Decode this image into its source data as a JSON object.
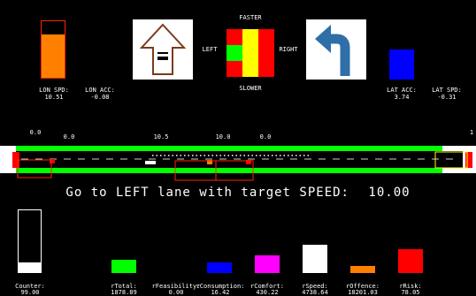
{
  "top": {
    "lon_spd_label": "LON SPD:",
    "lon_spd_value": "10.51",
    "lon_acc_label": "LON ACC:",
    "lon_acc_value": "-0.08",
    "lat_acc_label": "LAT ACC:",
    "lat_acc_value": "3.74",
    "lat_spd_label": "LAT SPD:",
    "lat_spd_value": "-0.31",
    "faster_label": "FASTER",
    "slower_label": "SLOWER",
    "left_label": "LEFT",
    "right_label": "RIGHT",
    "lon_spd_fill_fraction": 0.76,
    "colors": {
      "orange": "#ff8000",
      "blue": "#0000ff",
      "green": "#00ff00",
      "red": "#ff0000",
      "yellow": "#ffff00"
    }
  },
  "road": {
    "distance_labels": [
      "0.0",
      "0.0",
      "10.5",
      "10.0",
      "0.0",
      "1"
    ],
    "colors": {
      "lane": "#00ff00",
      "vehicle": "#ff0000"
    }
  },
  "instruction": {
    "text": "Go to LEFT lane with target SPEED:",
    "speed": "10.00"
  },
  "bottom": {
    "metrics": [
      {
        "label": "Counter:",
        "value": "99.00",
        "color": "#ffffff"
      },
      {
        "label": "rTotal:",
        "value": "1878.89",
        "color": "#00ff00"
      },
      {
        "label": "rFeasibility:",
        "value": "0.00",
        "color": "#000000"
      },
      {
        "label": "rConsumption:",
        "value": "16.42",
        "color": "#0000ff"
      },
      {
        "label": "rComfort:",
        "value": "430.22",
        "color": "#ff00ff"
      },
      {
        "label": "rSpeed:",
        "value": "4738.64",
        "color": "#ffffff"
      },
      {
        "label": "rOffence:",
        "value": "18201.03",
        "color": "#ff8000"
      },
      {
        "label": "rRisk:",
        "value": "78.05",
        "color": "#ff0000"
      }
    ],
    "counter_fill_fraction": 0.16
  }
}
